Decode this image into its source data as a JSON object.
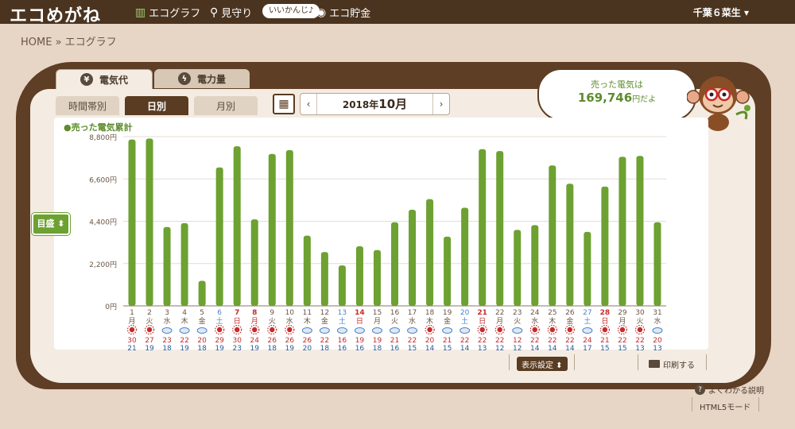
{
  "header": {
    "logo": "エコめがね",
    "nav": [
      {
        "label": "エコグラフ",
        "icon": "bar-chart-icon"
      },
      {
        "label": "見守り",
        "icon": "magnifier-icon"
      },
      {
        "label": "エコ貯金",
        "icon": "coin-icon"
      }
    ],
    "badge": "いいかんじ♪",
    "user": "千葉６菜生 ▾"
  },
  "breadcrumb": "HOME » エコグラフ",
  "tabs": {
    "main": [
      {
        "label": "電気代",
        "icon": "yen-icon",
        "active": true
      },
      {
        "label": "電力量",
        "icon": "bolt-icon",
        "active": false
      }
    ],
    "sub": [
      {
        "label": "時間帯別",
        "active": false
      },
      {
        "label": "日別",
        "active": true
      },
      {
        "label": "月別",
        "active": false
      }
    ]
  },
  "date_nav": {
    "year": "2018年",
    "month": "10月",
    "prev": "‹",
    "next": "›"
  },
  "speech": {
    "line1": "売った電気は",
    "amount": "169,746",
    "suffix": "円だよ"
  },
  "mode_select": "目盛 ⬍",
  "bottom": {
    "display_settings": "表示設定 ⬍",
    "print": "印刷する"
  },
  "help": "よくわかる説明",
  "html5": "HTML5モード",
  "colors": {
    "bar": "#6da131",
    "sun": "#c42c2c",
    "saturday": "#4a86c8",
    "holiday": "#c42c2c",
    "board": "#5e3e24"
  },
  "chart_data": {
    "type": "bar",
    "legend": "●売った電気累計",
    "ylim": [
      0,
      8800
    ],
    "yticks": [
      "8,800円",
      "6,600円",
      "4,400円",
      "2,200円",
      "0円"
    ],
    "ytick_values": [
      8800,
      6600,
      4400,
      2200,
      0
    ],
    "days": [
      "1",
      "2",
      "3",
      "4",
      "5",
      "6",
      "7",
      "8",
      "9",
      "10",
      "11",
      "12",
      "13",
      "14",
      "15",
      "16",
      "17",
      "18",
      "19",
      "20",
      "21",
      "22",
      "23",
      "24",
      "25",
      "26",
      "27",
      "28",
      "29",
      "30",
      "31"
    ],
    "weekdays": [
      "月",
      "火",
      "水",
      "木",
      "金",
      "土",
      "日",
      "月",
      "火",
      "水",
      "木",
      "金",
      "土",
      "日",
      "月",
      "火",
      "水",
      "木",
      "金",
      "土",
      "日",
      "月",
      "火",
      "水",
      "木",
      "金",
      "土",
      "日",
      "月",
      "火",
      "水"
    ],
    "day_colors": [
      "n",
      "n",
      "n",
      "n",
      "n",
      "sat",
      "hol",
      "hol",
      "n",
      "n",
      "n",
      "n",
      "sat",
      "hol",
      "n",
      "n",
      "n",
      "n",
      "n",
      "sat",
      "hol",
      "n",
      "n",
      "n",
      "n",
      "n",
      "sat",
      "hol",
      "n",
      "n",
      "n"
    ],
    "values": [
      8650,
      8700,
      4100,
      4300,
      1300,
      7200,
      8300,
      4500,
      7900,
      8100,
      3650,
      2800,
      2100,
      3100,
      2900,
      4350,
      5000,
      5550,
      3600,
      5100,
      8150,
      8050,
      3950,
      4200,
      7300,
      6350,
      3850,
      6200,
      7750,
      7800,
      4350
    ],
    "weather": [
      "sun",
      "sun",
      "cloud",
      "cloud",
      "cloud",
      "sun",
      "sun",
      "sun",
      "sun",
      "sun",
      "cloud",
      "cloud",
      "cloud",
      "cloud",
      "cloud",
      "cloud",
      "cloud",
      "sun",
      "cloud",
      "cloud",
      "sun",
      "sun",
      "cloud",
      "sun",
      "sun",
      "sun",
      "cloud",
      "sun",
      "sun",
      "sun",
      "cloud"
    ],
    "temp_high": [
      "30",
      "27",
      "23",
      "22",
      "20",
      "29",
      "30",
      "24",
      "26",
      "26",
      "26",
      "22",
      "16",
      "19",
      "19",
      "21",
      "22",
      "20",
      "21",
      "22",
      "22",
      "22",
      "12",
      "22",
      "22",
      "22",
      "24",
      "21",
      "22",
      "22",
      "20"
    ],
    "temp_low": [
      "21",
      "19",
      "18",
      "19",
      "18",
      "19",
      "23",
      "19",
      "18",
      "19",
      "20",
      "18",
      "16",
      "16",
      "18",
      "16",
      "15",
      "14",
      "15",
      "14",
      "13",
      "12",
      "12",
      "14",
      "14",
      "14",
      "17",
      "15",
      "15",
      "13",
      "13"
    ]
  }
}
